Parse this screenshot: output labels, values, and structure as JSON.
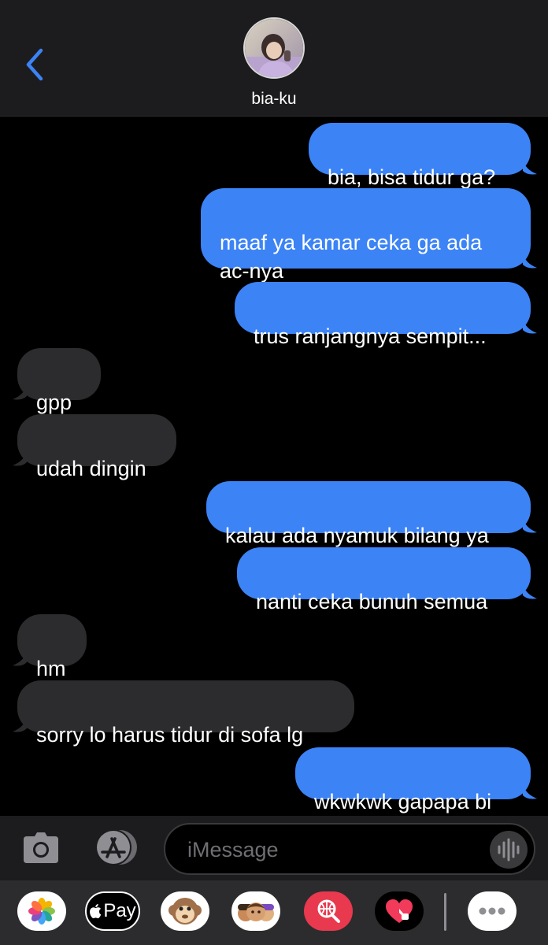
{
  "header": {
    "contact_name": "bia-ku",
    "back_icon": "chevron-left-icon",
    "avatar_icon": "contact-avatar"
  },
  "messages": [
    {
      "side": "sent",
      "text": "bia, bisa tidur ga?"
    },
    {
      "side": "sent",
      "text": "maaf ya kamar ceka ga ada\nac-nya"
    },
    {
      "side": "sent",
      "text": "trus ranjangnya sempit..."
    },
    {
      "side": "recv",
      "text": "gpp"
    },
    {
      "side": "recv",
      "text": "udah dingin"
    },
    {
      "side": "sent",
      "text": "kalau ada nyamuk bilang ya"
    },
    {
      "side": "sent",
      "text": "nanti ceka bunuh semua"
    },
    {
      "side": "recv",
      "text": "hm"
    },
    {
      "side": "recv",
      "text": "sorry lo harus tidur di sofa lg"
    },
    {
      "side": "sent",
      "text": "wkwkwk gapapa bi"
    }
  ],
  "input_bar": {
    "placeholder": "iMessage",
    "camera_icon": "camera-icon",
    "appstore_icon": "app-store-icon",
    "audio_icon": "audio-waveform-icon"
  },
  "app_drawer": {
    "apps": [
      {
        "name": "photos-app-icon"
      },
      {
        "name": "apple-pay-app-icon",
        "label": "Pay"
      },
      {
        "name": "animoji-app-icon"
      },
      {
        "name": "memoji-app-icon"
      },
      {
        "name": "image-search-app-icon"
      },
      {
        "name": "digital-touch-app-icon"
      },
      {
        "name": "more-apps-icon"
      }
    ]
  },
  "colors": {
    "sent_bubble": "#3c83f5",
    "received_bubble": "#2c2c2e",
    "accent": "#3c83f5",
    "background": "#000000"
  }
}
